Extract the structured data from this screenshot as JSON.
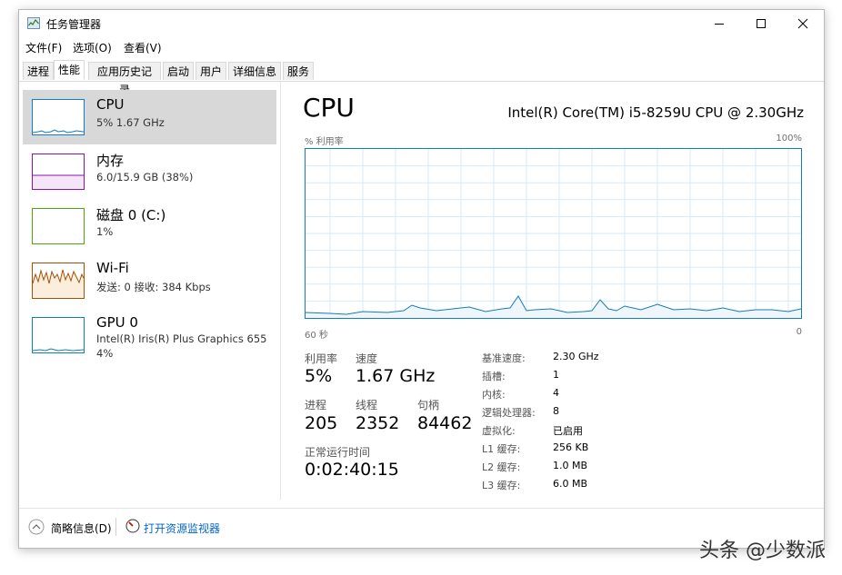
{
  "window": {
    "title": "任务管理器"
  },
  "menu": [
    "文件(F)",
    "选项(O)",
    "查看(V)"
  ],
  "tabs": [
    "进程",
    "性能",
    "应用历史记录",
    "启动",
    "用户",
    "详细信息",
    "服务"
  ],
  "active_tab": "性能",
  "sidebar": {
    "items": [
      {
        "title": "CPU",
        "sub1": "5% 1.67 GHz",
        "color": "#117dbb",
        "active": true
      },
      {
        "title": "内存",
        "sub1": "6.0/15.9 GB (38%)",
        "color": "#8b12ae"
      },
      {
        "title": "磁盘 0 (C:)",
        "sub1": "1%",
        "color": "#4da60c"
      },
      {
        "title": "Wi-Fi",
        "sub1": "发送: 0 接收: 384 Kbps",
        "color": "#a74f01"
      },
      {
        "title": "GPU 0",
        "sub1": "Intel(R) Iris(R) Plus Graphics 655",
        "sub2": "4%",
        "color": "#117dbb"
      }
    ]
  },
  "main": {
    "title": "CPU",
    "cpu_name": "Intel(R) Core(TM) i5-8259U CPU @ 2.30GHz",
    "graph_top_left": "% 利用率",
    "graph_top_right": "100%",
    "graph_bottom_left": "60 秒",
    "graph_bottom_right": "0",
    "stats": {
      "util_label": "利用率",
      "util_value": "5%",
      "speed_label": "速度",
      "speed_value": "1.67 GHz",
      "proc_label": "进程",
      "proc_value": "205",
      "thread_label": "线程",
      "thread_value": "2352",
      "handle_label": "句柄",
      "handle_value": "84462",
      "uptime_label": "正常运行时间",
      "uptime_value": "0:02:40:15"
    },
    "details": [
      {
        "label": "基准速度:",
        "value": "2.30 GHz"
      },
      {
        "label": "插槽:",
        "value": "1"
      },
      {
        "label": "内核:",
        "value": "4"
      },
      {
        "label": "逻辑处理器:",
        "value": "8"
      },
      {
        "label": "虚拟化:",
        "value": "已启用"
      },
      {
        "label": "L1 缓存:",
        "value": "256 KB"
      },
      {
        "label": "L2 缓存:",
        "value": "1.0 MB"
      },
      {
        "label": "L3 缓存:",
        "value": "6.0 MB"
      }
    ]
  },
  "footer": {
    "brief": "简略信息(D)",
    "monitor": "打开资源监视器"
  },
  "watermark": "头条 @少数派",
  "colors": {
    "cpu": "#117dbb",
    "memory": "#8b12ae",
    "disk": "#4da60c",
    "wifi": "#a74f01",
    "link": "#0066cc"
  }
}
